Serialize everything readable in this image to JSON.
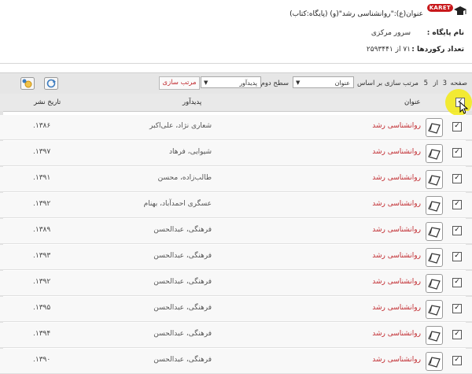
{
  "header": {
    "badge_text": "KARET",
    "query": "عنوان(ع):\"روانشناسی رشد\"(و) (پایگاه:کتاب)",
    "db_label": "نام پایگاه :",
    "db_value": "سرور مرکزی",
    "count_label": "تعداد رکوردها :",
    "count_value": "۷۱ از ۲۵۹۳۴۴۱"
  },
  "toolbar": {
    "page_label": "صفحه",
    "page_current": "3",
    "page_of": "از",
    "page_total": "5",
    "sort_by_label": "مرتب سازی بر اساس",
    "sort_primary": "عنوان",
    "level2_label": "سطح دوم",
    "sort_secondary": "پدیدآور",
    "sort_button": "مرتب سازی"
  },
  "table": {
    "headers": {
      "title": "عنوان",
      "author": "پدیدآور",
      "date": "تاریخ نشر"
    },
    "rows": [
      {
        "title": "روانشناسی رشد",
        "author": "شعاری نژاد، علی‌اکبر",
        "date": "۱۳۸۶."
      },
      {
        "title": "روانشناسی رشد",
        "author": "شیوایی، فرهاد",
        "date": "۱۳۹۷."
      },
      {
        "title": "روانشناسی رشد",
        "author": "طالب‌زاده، محسن",
        "date": "۱۳۹۱."
      },
      {
        "title": "روانشناسی رشد",
        "author": "عسگری احمدآباد، بهنام",
        "date": "۱۳۹۲."
      },
      {
        "title": "روانشناسی رشد",
        "author": "فرهنگی، عبدالحسن",
        "date": "۱۳۸۹."
      },
      {
        "title": "روانشناسی رشد",
        "author": "فرهنگی، عبدالحسن",
        "date": "۱۳۹۳."
      },
      {
        "title": "روانشناسی رشد",
        "author": "فرهنگی، عبدالحسن",
        "date": "۱۳۹۲."
      },
      {
        "title": "روانشناسی رشد",
        "author": "فرهنگی، عبدالحسن",
        "date": "۱۳۹۵."
      },
      {
        "title": "روانشناسی رشد",
        "author": "فرهنگی، عبدالحسن",
        "date": "۱۳۹۴."
      },
      {
        "title": "روانشناسی رشد",
        "author": "فرهنگی، عبدالحسن",
        "date": "۱۳۹۰."
      }
    ]
  },
  "colors": {
    "accent": "#c0292e",
    "highlight": "#f3ea1f"
  },
  "icons": [
    "graduation-cap-icon",
    "book-icon",
    "refresh-icon",
    "clear-search-icon",
    "cursor-icon",
    "chevron-down-icon"
  ]
}
